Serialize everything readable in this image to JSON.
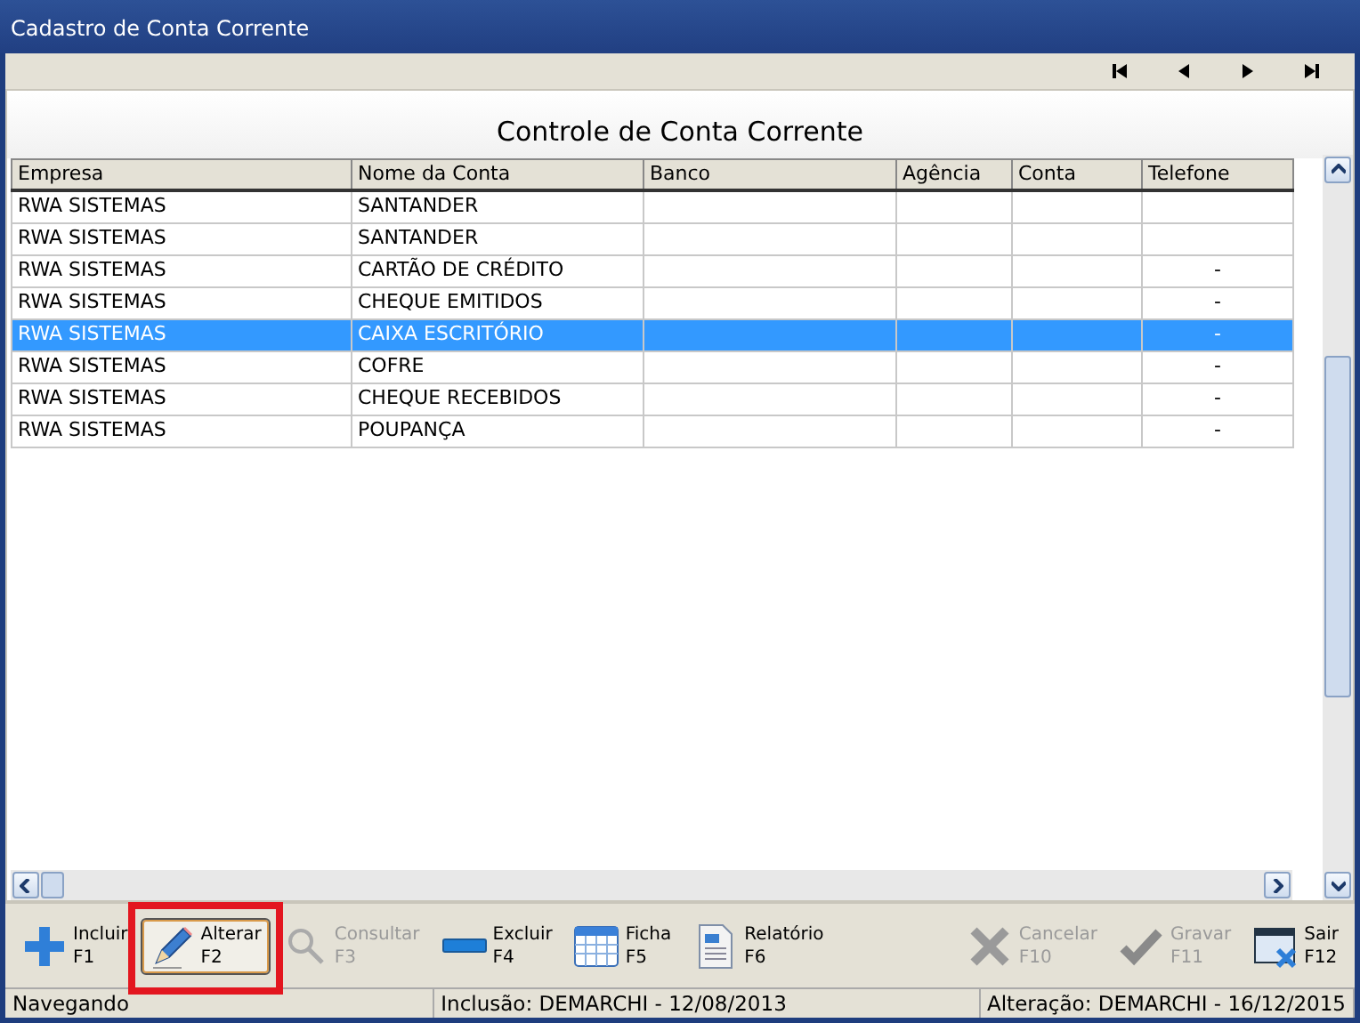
{
  "window": {
    "title": "Cadastro de Conta Corrente"
  },
  "navigation": [
    {
      "kind": "first"
    },
    {
      "kind": "prev"
    },
    {
      "kind": "next"
    },
    {
      "kind": "last"
    }
  ],
  "panel_title": "Controle de Conta Corrente",
  "table": {
    "columns": [
      "Empresa",
      "Nome da Conta",
      "Banco",
      "Agência",
      "Conta",
      "Telefone"
    ],
    "rows": [
      {
        "cells": [
          "RWA SISTEMAS",
          "SANTANDER",
          "",
          "",
          "",
          ""
        ],
        "selected": false
      },
      {
        "cells": [
          "RWA SISTEMAS",
          "SANTANDER",
          "",
          "",
          "",
          ""
        ],
        "selected": false
      },
      {
        "cells": [
          "RWA SISTEMAS",
          "CARTÃO DE CRÉDITO",
          "",
          "",
          "",
          "-"
        ],
        "selected": false
      },
      {
        "cells": [
          "RWA SISTEMAS",
          "CHEQUE EMITIDOS",
          "",
          "",
          "",
          "-"
        ],
        "selected": false
      },
      {
        "cells": [
          "RWA SISTEMAS",
          "CAIXA ESCRITÓRIO",
          "",
          "",
          "",
          "-"
        ],
        "selected": true
      },
      {
        "cells": [
          "RWA SISTEMAS",
          "COFRE",
          "",
          "",
          "",
          "-"
        ],
        "selected": false
      },
      {
        "cells": [
          "RWA SISTEMAS",
          "CHEQUE RECEBIDOS",
          "",
          "",
          "",
          "-"
        ],
        "selected": false
      },
      {
        "cells": [
          "RWA SISTEMAS",
          "POUPANÇA",
          "",
          "",
          "",
          "-"
        ],
        "selected": false
      }
    ]
  },
  "toolbar": [
    {
      "kind": "plus",
      "label": "Incluir",
      "key": "F1",
      "disabled": false,
      "highlighted": false
    },
    {
      "kind": "pencil",
      "label": "Alterar",
      "key": "F2",
      "disabled": false,
      "highlighted": true
    },
    {
      "kind": "search",
      "label": "Consultar",
      "key": "F3",
      "disabled": true,
      "highlighted": false
    },
    {
      "kind": "minus",
      "label": "Excluir",
      "key": "F4",
      "disabled": false,
      "highlighted": false
    },
    {
      "kind": "grid",
      "label": "Ficha",
      "key": "F5",
      "disabled": false,
      "highlighted": false
    },
    {
      "kind": "report",
      "label": "Relatório",
      "key": "F6",
      "disabled": false,
      "highlighted": false
    },
    {
      "kind": "cancel",
      "label": "Cancelar",
      "key": "F10",
      "disabled": true,
      "highlighted": false
    },
    {
      "kind": "check",
      "label": "Gravar",
      "key": "F11",
      "disabled": true,
      "highlighted": false
    },
    {
      "kind": "exit",
      "label": "Sair",
      "key": "F12",
      "disabled": false,
      "highlighted": false
    }
  ],
  "status_bar": [
    "Navegando",
    "Inclusão: DEMARCHI - 12/08/2013",
    "Alteração: DEMARCHI - 16/12/2015"
  ]
}
